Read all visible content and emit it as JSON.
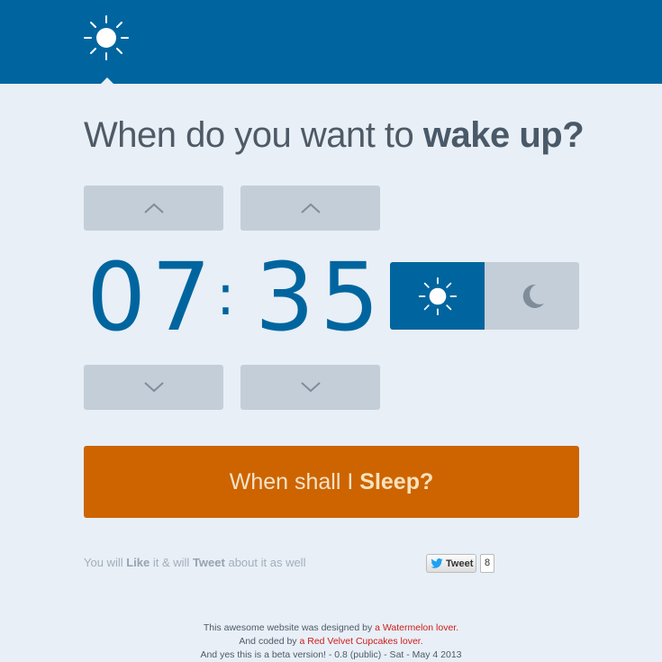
{
  "header": {
    "logo_icon": "sun-icon",
    "color": "#00659f"
  },
  "question": {
    "prefix": "When do you want to",
    "emphasis": "wake up?"
  },
  "time": {
    "hours": "07",
    "separator": ":",
    "minutes": "35"
  },
  "controls": {
    "up_icon": "chevron-up-icon",
    "down_icon": "chevron-down-icon",
    "am_icon": "sun-icon",
    "pm_icon": "moon-icon",
    "selected_period": "am"
  },
  "action": {
    "prefix": "When shall I",
    "emphasis": "Sleep?",
    "color": "#cd6400"
  },
  "share": {
    "text_1": "You will",
    "like": "Like",
    "text_2": "it & will",
    "tweet": "Tweet",
    "text_3": "about it as well",
    "tweet_button": "Tweet",
    "tweet_count": "8"
  },
  "footer": {
    "line1_text": "This awesome website was designed by",
    "line1_link": "a Watermelon lover.",
    "line2_text": "And coded by",
    "line2_link": "a Red Velvet Cupcakes lover.",
    "line3_text": "And yes this is a beta version! - 0.8 (public) - Sat - May 4 2013"
  }
}
